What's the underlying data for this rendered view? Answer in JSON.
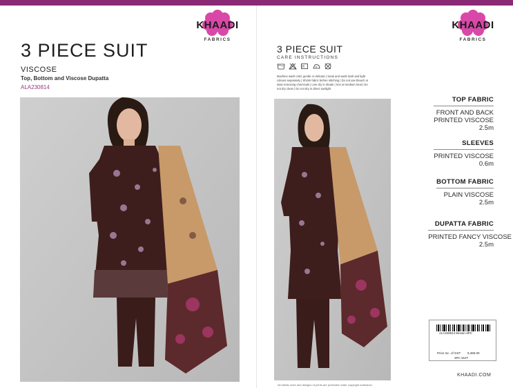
{
  "brand": {
    "name": "KHAADI",
    "tagline": "FABRICS",
    "accent_color": "#8a2a74",
    "flower_color": "#d948a8"
  },
  "left": {
    "title": "3 PIECE SUIT",
    "fabric": "VISCOSE",
    "description": "Top, Bottom and Viscose  Dupatta",
    "article_code": "ALA230814"
  },
  "right": {
    "title": "3 PIECE SUIT",
    "care_heading": "CARE INSTRUCTIONS",
    "care_icons": [
      "wash-icon",
      "no-bleach-icon",
      "dry-icon",
      "iron-icon",
      "no-dry-clean-icon"
    ],
    "care_text": "Machine wash cold, gentle or delicate | Soak and wash dark and light colours separately | Shrink fabric before stitching | Do not use bleach or stain removing chemicals | Line dry in shade | Iron at medium heat | Do not dry clean | Do not dry in direct sunlight"
  },
  "specs": [
    {
      "heading": "TOP FABRIC",
      "lines": [
        "FRONT AND BACK",
        "PRINTED VISCOSE",
        "2.5m"
      ]
    },
    {
      "heading": "SLEEVES",
      "lines": [
        "PRINTED VISCOSE",
        "0.6m"
      ]
    },
    {
      "heading": "BOTTOM FABRIC",
      "lines": [
        "PLAIN VISCOSE",
        "2.5m"
      ]
    },
    {
      "heading": "DUPATTA FABRIC",
      "lines": [
        "PRINTED FANCY VISCOSE",
        "2.5m"
      ]
    }
  ],
  "barcode": {
    "code": "ALA230814-Brown-3PC",
    "price_label": "Price Inc. of GST",
    "price": "5,480.00",
    "pack": "3PC SUIT"
  },
  "website": "KHAADI.COM",
  "footer_note": "All artistic work and designs of prints are protected under copyright ordinance."
}
